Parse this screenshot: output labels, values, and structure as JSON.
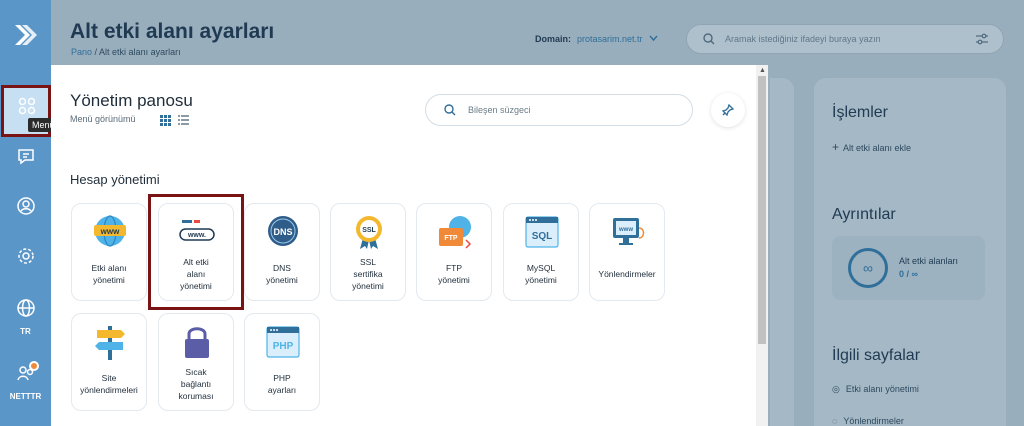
{
  "header": {
    "page_title": "Alt etki alanı ayarları",
    "breadcrumb_home": "Pano",
    "breadcrumb_sep": " / ",
    "breadcrumb_current": "Alt etki alanı ayarları",
    "domain_label": "Domain:",
    "domain_value": "protasarim.net.tr",
    "search_placeholder": "Aramak istediğiniz ifadeyi buraya yazın"
  },
  "rail": {
    "tooltip": "Menü",
    "language": "TR",
    "account": "NETTTR"
  },
  "modal": {
    "title": "Yönetim panosu",
    "view_label": "Menü görünümü",
    "filter_placeholder": "Bileşen süzgeci",
    "section_title": "Hesap yönetimi",
    "tiles": [
      {
        "line1": "Etki alanı",
        "line2": "yönetimi",
        "line3": "",
        "icon": "www-globe-icon"
      },
      {
        "line1": "Alt etki",
        "line2": "alanı",
        "line3": "yönetimi",
        "icon": "subdomain-www-icon"
      },
      {
        "line1": "DNS",
        "line2": "yönetimi",
        "line3": "",
        "icon": "dns-icon"
      },
      {
        "line1": "SSL",
        "line2": "sertifika",
        "line3": "yönetimi",
        "icon": "ssl-badge-icon"
      },
      {
        "line1": "FTP",
        "line2": "yönetimi",
        "line3": "",
        "icon": "ftp-icon"
      },
      {
        "line1": "MySQL",
        "line2": "yönetimi",
        "line3": "",
        "icon": "mysql-icon"
      },
      {
        "line1": "Yönlendirmeler",
        "line2": "",
        "line3": "",
        "icon": "redirect-monitor-icon"
      },
      {
        "line1": "Site",
        "line2": "yönlendirmeleri",
        "line3": "",
        "icon": "signpost-icon"
      },
      {
        "line1": "Sıcak",
        "line2": "bağlantı",
        "line3": "koruması",
        "icon": "padlock-icon"
      },
      {
        "line1": "PHP",
        "line2": "ayarları",
        "line3": "",
        "icon": "php-icon"
      }
    ]
  },
  "side": {
    "actions_title": "İşlemler",
    "add_subdomain": "Alt etki alanı ekle",
    "details_title": "Ayrıntılar",
    "detail_name": "Alt etki alanları",
    "detail_used": "0",
    "detail_sep": " / ",
    "detail_limit": "∞",
    "infinity_symbol": "∞",
    "related_title": "İlgili sayfalar",
    "related_1": "Etki alanı yönetimi",
    "related_2": "Yönlendirmeler"
  },
  "colors": {
    "rail": "#5b96c9",
    "overlay": "#99aebc",
    "highlight": "#7a1414",
    "accent": "#2f6f9a"
  }
}
